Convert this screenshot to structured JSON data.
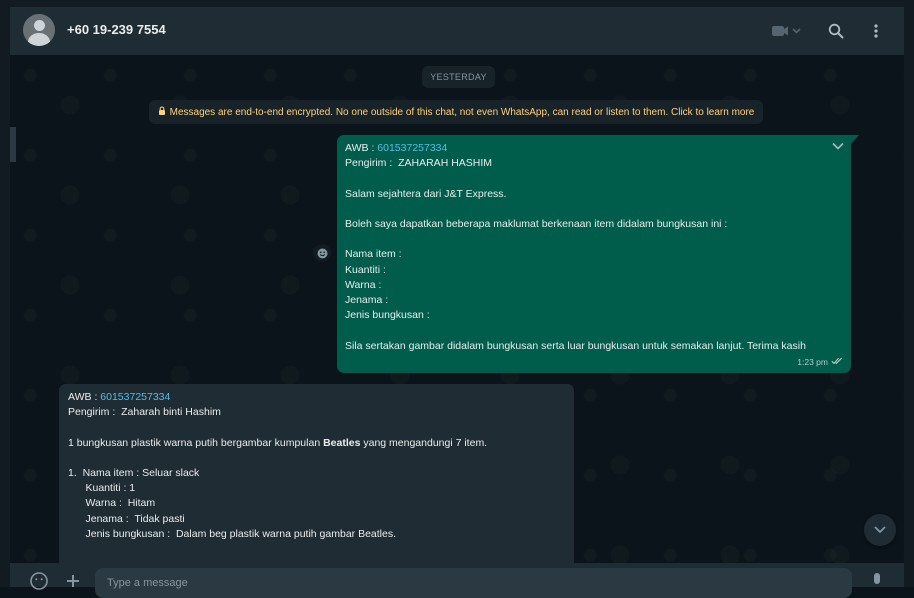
{
  "header": {
    "contact_name": "+60 19-239 7554",
    "icons": [
      "video-call-icon",
      "search-icon",
      "menu-icon"
    ]
  },
  "chat": {
    "date_chip": "YESTERDAY",
    "encryption_notice": "Messages are end-to-end encrypted. No one outside of this chat, not even WhatsApp, can read or listen to them. Click to learn more",
    "outgoing": {
      "awb_label": "AWB : ",
      "awb_number": "601537257334",
      "lines": [
        "Pengirim :  ZAHARAH HASHIM",
        "",
        "Salam sejahtera dari J&T Express.",
        "",
        "Boleh saya dapatkan beberapa maklumat berkenaan item didalam bungkusan ini :",
        "",
        "Nama item :",
        "Kuantiti :",
        "Warna :",
        "Jenama :",
        "Jenis bungkusan :",
        "",
        "Sila sertakan gambar didalam bungkusan serta luar bungkusan untuk semakan lanjut. Terima kasih"
      ],
      "time": "1:23 pm"
    },
    "incoming": {
      "awb_label": "AWB : ",
      "awb_number": "601537257334",
      "line_sender": "Pengirim :  Zaharah binti Hashim",
      "desc_before": "1 bungkusan plastik warna putih bergambar kumpulan ",
      "desc_bold": "Beatles",
      "desc_after": " yang mengandungi 7 item.",
      "item_lines": [
        "1.  Nama item : Seluar slack",
        "      Kuantiti : 1",
        "      Warna :  Hitam",
        "      Jenama :  Tidak pasti",
        "      Jenis bungkusan :  Dalam beg plastik warna putih gambar Beatles."
      ]
    }
  },
  "footer": {
    "placeholder": "Type a message",
    "icons": [
      "emoji-icon",
      "attach-icon",
      "mic-icon"
    ]
  },
  "colors": {
    "accent_outgoing": "#005c4b",
    "incoming_bubble": "#202c33",
    "link": "#53bdeb",
    "encryption_text": "#ffd279"
  }
}
